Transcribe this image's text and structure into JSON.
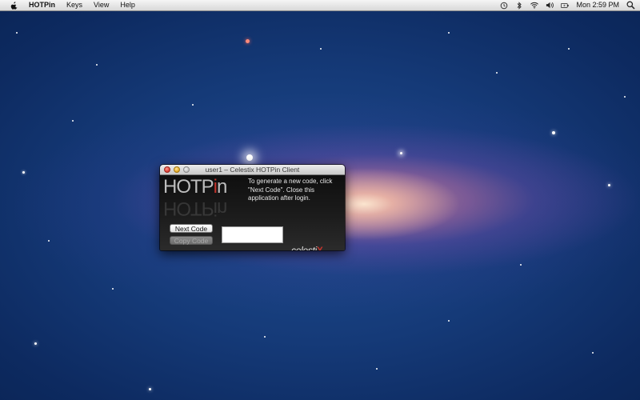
{
  "menubar": {
    "app_name": "HOTPin",
    "menus": [
      "Keys",
      "View",
      "Help"
    ],
    "clock": "Mon 2:59 PM",
    "status_icons": [
      "time-machine-icon",
      "bluetooth-icon",
      "wifi-icon",
      "volume-icon",
      "battery-icon",
      "spotlight-icon"
    ]
  },
  "window": {
    "title": "user1 – Celestix HOTPin Client",
    "logo_text": "HOTP",
    "logo_i": "i",
    "logo_n": "n",
    "instructions": "To generate a new code, click \"Next Code\". Close this application after login.",
    "next_button": "Next Code",
    "copy_button": "Copy Code",
    "code_value": "",
    "brand_text": "celesti",
    "brand_x": "X"
  },
  "colors": {
    "accent_red": "#c0342d",
    "window_bg": "#1c1c1c"
  }
}
